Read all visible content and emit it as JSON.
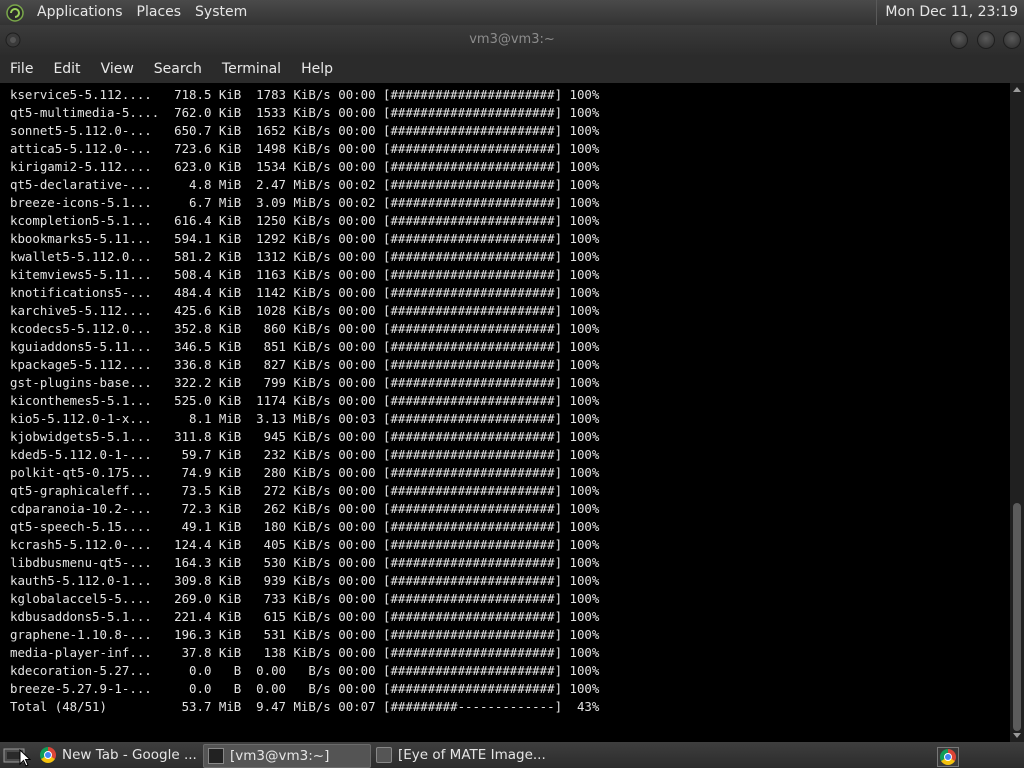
{
  "top_panel": {
    "menus": [
      "Applications",
      "Places",
      "System"
    ],
    "clock": "Mon Dec 11, 23:19"
  },
  "window": {
    "title": "vm3@vm3:~",
    "menu": [
      "File",
      "Edit",
      "View",
      "Search",
      "Terminal",
      "Help"
    ]
  },
  "terminal": {
    "lines": [
      "kservice5-5.112....   718.5 KiB  1783 KiB/s 00:00 [######################] 100%",
      "qt5-multimedia-5....  762.0 KiB  1533 KiB/s 00:00 [######################] 100%",
      "sonnet5-5.112.0-...   650.7 KiB  1652 KiB/s 00:00 [######################] 100%",
      "attica5-5.112.0-...   723.6 KiB  1498 KiB/s 00:00 [######################] 100%",
      "kirigami2-5.112....   623.0 KiB  1534 KiB/s 00:00 [######################] 100%",
      "qt5-declarative-...     4.8 MiB  2.47 MiB/s 00:02 [######################] 100%",
      "breeze-icons-5.1...     6.7 MiB  3.09 MiB/s 00:02 [######################] 100%",
      "kcompletion5-5.1...   616.4 KiB  1250 KiB/s 00:00 [######################] 100%",
      "kbookmarks5-5.11...   594.1 KiB  1292 KiB/s 00:00 [######################] 100%",
      "kwallet5-5.112.0...   581.2 KiB  1312 KiB/s 00:00 [######################] 100%",
      "kitemviews5-5.11...   508.4 KiB  1163 KiB/s 00:00 [######################] 100%",
      "knotifications5-...   484.4 KiB  1142 KiB/s 00:00 [######################] 100%",
      "karchive5-5.112....   425.6 KiB  1028 KiB/s 00:00 [######################] 100%",
      "kcodecs5-5.112.0...   352.8 KiB   860 KiB/s 00:00 [######################] 100%",
      "kguiaddons5-5.11...   346.5 KiB   851 KiB/s 00:00 [######################] 100%",
      "kpackage5-5.112....   336.8 KiB   827 KiB/s 00:00 [######################] 100%",
      "gst-plugins-base...   322.2 KiB   799 KiB/s 00:00 [######################] 100%",
      "kiconthemes5-5.1...   525.0 KiB  1174 KiB/s 00:00 [######################] 100%",
      "kio5-5.112.0-1-x...     8.1 MiB  3.13 MiB/s 00:03 [######################] 100%",
      "kjobwidgets5-5.1...   311.8 KiB   945 KiB/s 00:00 [######################] 100%",
      "kded5-5.112.0-1-...    59.7 KiB   232 KiB/s 00:00 [######################] 100%",
      "polkit-qt5-0.175...    74.9 KiB   280 KiB/s 00:00 [######################] 100%",
      "qt5-graphicaleff...    73.5 KiB   272 KiB/s 00:00 [######################] 100%",
      "cdparanoia-10.2-...    72.3 KiB   262 KiB/s 00:00 [######################] 100%",
      "qt5-speech-5.15....    49.1 KiB   180 KiB/s 00:00 [######################] 100%",
      "kcrash5-5.112.0-...   124.4 KiB   405 KiB/s 00:00 [######################] 100%",
      "libdbusmenu-qt5-...   164.3 KiB   530 KiB/s 00:00 [######################] 100%",
      "kauth5-5.112.0-1...   309.8 KiB   939 KiB/s 00:00 [######################] 100%",
      "kglobalaccel5-5....   269.0 KiB   733 KiB/s 00:00 [######################] 100%",
      "kdbusaddons5-5.1...   221.4 KiB   615 KiB/s 00:00 [######################] 100%",
      "graphene-1.10.8-...   196.3 KiB   531 KiB/s 00:00 [######################] 100%",
      "media-player-inf...    37.8 KiB   138 KiB/s 00:00 [######################] 100%",
      "kdecoration-5.27...     0.0   B  0.00   B/s 00:00 [######################] 100%",
      "breeze-5.27.9-1-...     0.0   B  0.00   B/s 00:00 [######################] 100%",
      "Total (48/51)          53.7 MiB  9.47 MiB/s 00:07 [#########-------------]  43%"
    ]
  },
  "taskbar": {
    "tasks": [
      {
        "label": "New Tab - Google ...",
        "icon": "chrome-icon"
      },
      {
        "label": "[vm3@vm3:~]",
        "icon": "terminal-icon"
      },
      {
        "label": "[Eye of MATE Image...",
        "icon": "image-viewer-icon"
      }
    ]
  }
}
